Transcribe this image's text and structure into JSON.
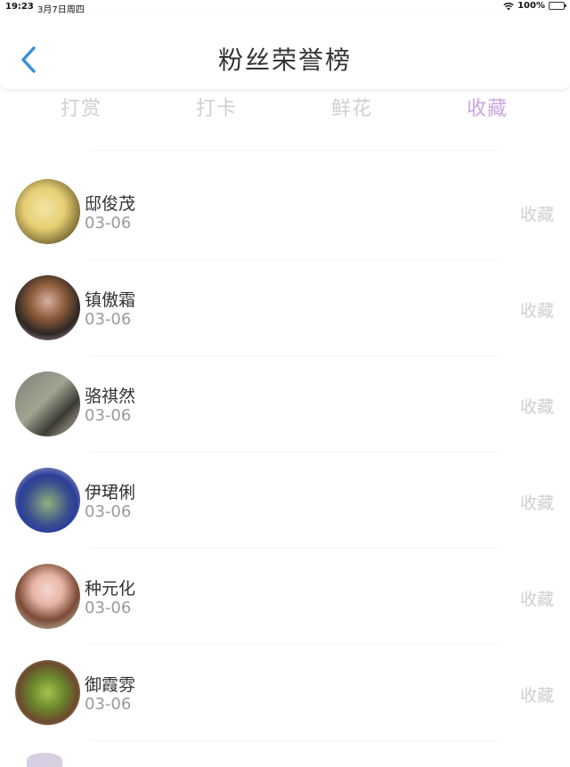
{
  "status_bar": {
    "time": "19:23",
    "date": "3月7日周四",
    "battery_percent": "100%"
  },
  "header": {
    "title": "粉丝荣誉榜"
  },
  "tabs": [
    {
      "label": "打赏",
      "active": false
    },
    {
      "label": "打卡",
      "active": false
    },
    {
      "label": "鲜花",
      "active": false
    },
    {
      "label": "收藏",
      "active": true
    }
  ],
  "list": [
    {
      "name": "邸俊茂",
      "date": "03-06",
      "action": "收藏"
    },
    {
      "name": "镇傲霜",
      "date": "03-06",
      "action": "收藏"
    },
    {
      "name": "骆祺然",
      "date": "03-06",
      "action": "收藏"
    },
    {
      "name": "伊珺俐",
      "date": "03-06",
      "action": "收藏"
    },
    {
      "name": "种元化",
      "date": "03-06",
      "action": "收藏"
    },
    {
      "name": "御霞雰",
      "date": "03-06",
      "action": "收藏"
    }
  ],
  "colors": {
    "accent": "#c9a6de",
    "back_icon": "#3a8fd8",
    "inactive_tab": "#cfcfcf"
  },
  "icons": {
    "back": "chevron-left-icon",
    "wifi": "wifi-icon",
    "battery": "battery-icon"
  }
}
